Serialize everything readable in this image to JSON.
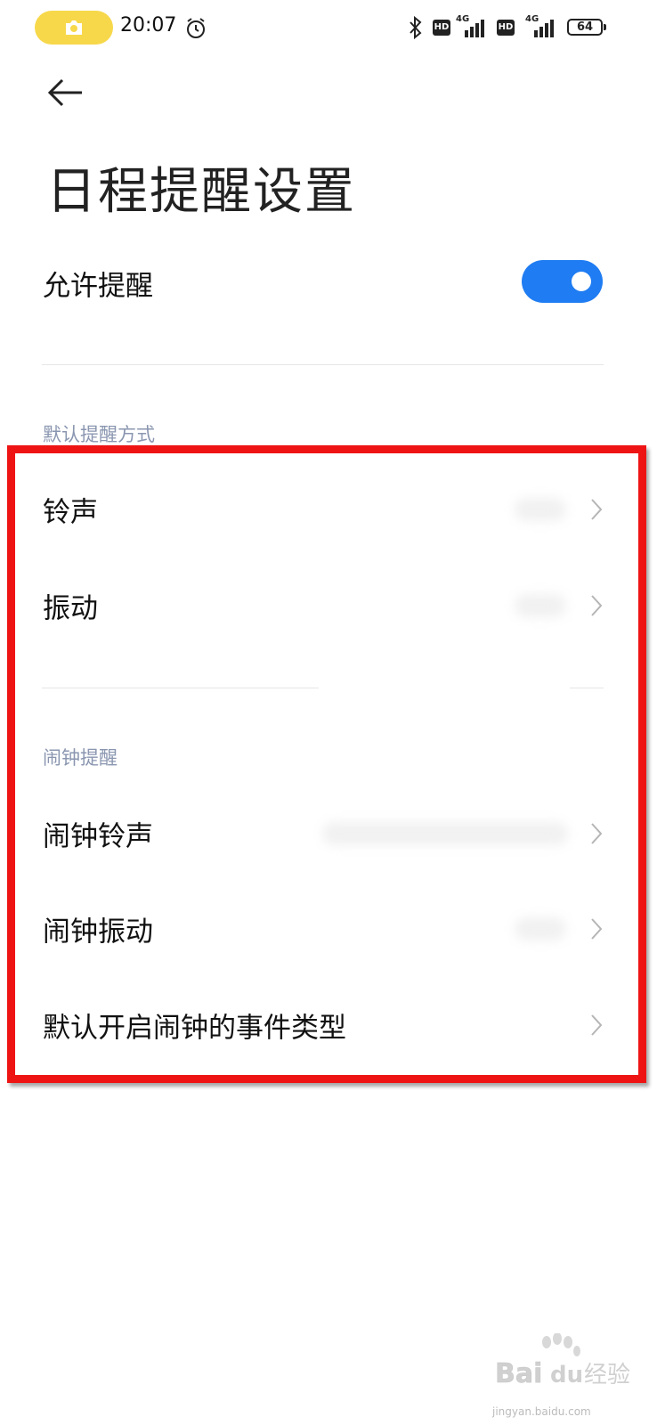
{
  "status_bar": {
    "time": "20:07",
    "hd1": "HD",
    "hd2": "HD",
    "net1": "4G",
    "net2": "4G",
    "battery": "64",
    "pill_color": "#f7d84a"
  },
  "header": {
    "title": "日程提醒设置"
  },
  "allow_reminder": {
    "label": "允许提醒",
    "enabled": true,
    "accent": "#1f7cf2"
  },
  "default_reminder": {
    "section_title": "默认提醒方式",
    "items": [
      {
        "label": "铃声"
      },
      {
        "label": "振动"
      }
    ]
  },
  "alarm_reminder": {
    "section_title": "闹钟提醒",
    "items": [
      {
        "label": "闹钟铃声"
      },
      {
        "label": "闹钟振动"
      },
      {
        "label": "默认开启闹钟的事件类型"
      }
    ]
  },
  "annotation": {
    "highlight_color": "#ee1414"
  },
  "watermark": {
    "brand": "Bai",
    "brand2": "du",
    "suffix": "经验",
    "url": "jingyan.baidu.com"
  }
}
